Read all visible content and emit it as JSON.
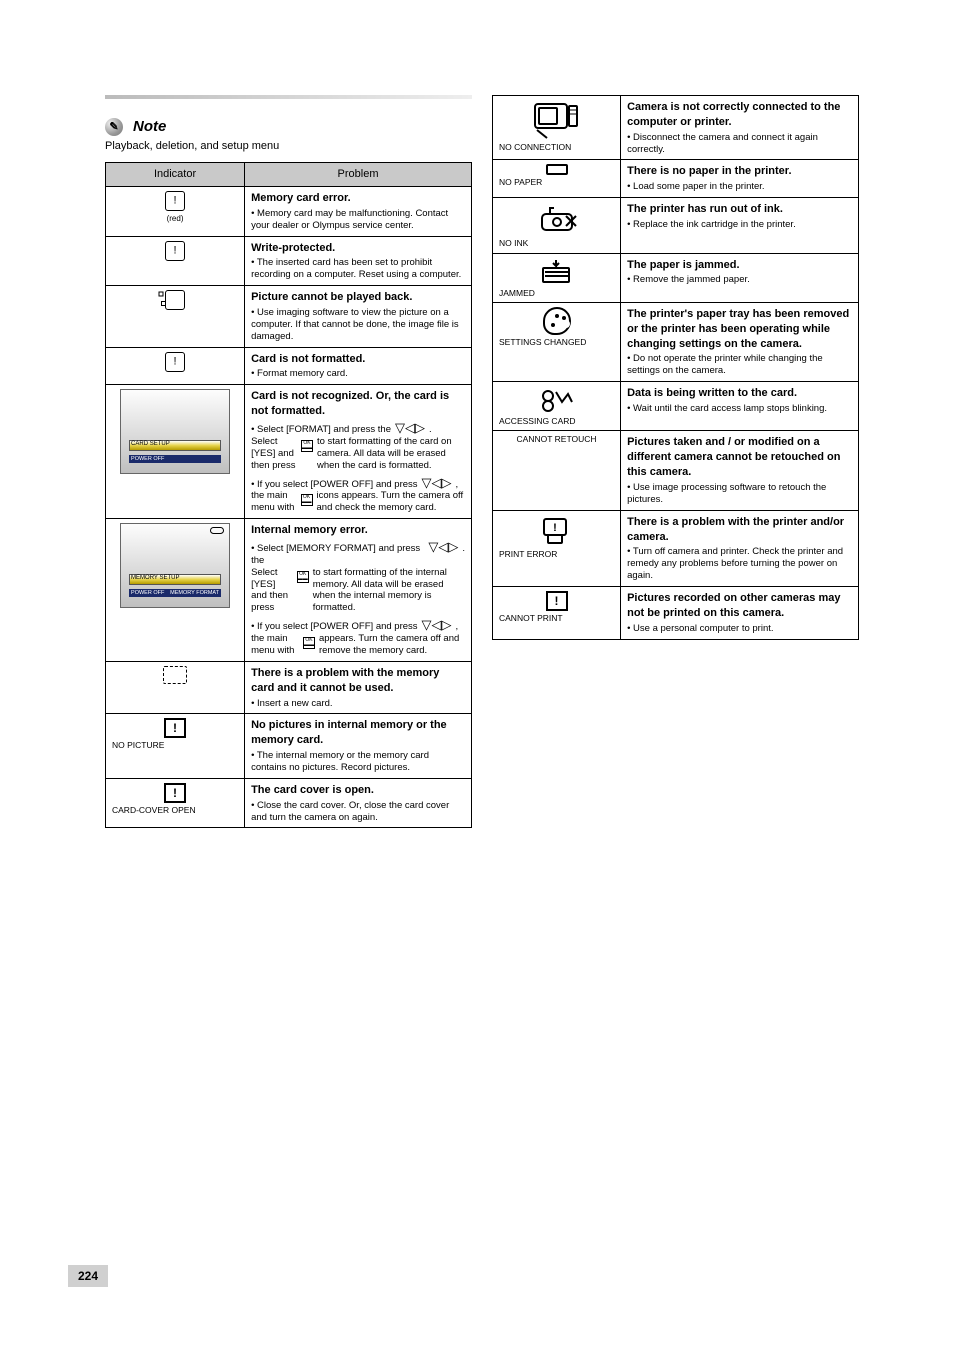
{
  "page_number": "224",
  "left": {
    "note_heading": "Note",
    "subtitle": "Playback, deletion, and setup menu",
    "header_indicator": "Indicator",
    "header_problem": "Problem",
    "rows": [
      {
        "key": "card1_red",
        "icon_caption": "(red)",
        "head": "Memory card error.",
        "desc": "• Memory card may be malfunctioning. Contact your dealer or Olympus service center."
      },
      {
        "key": "card2",
        "icon_caption": "",
        "head": "Write-protected.",
        "desc": "• The inserted card has been set to prohibit recording on a computer. Reset using a computer."
      },
      {
        "key": "card3",
        "icon_caption": "",
        "head": "Picture cannot be played back.",
        "desc": "• Use imaging software to view the picture on a computer. If that cannot be done, the image file is damaged."
      },
      {
        "key": "card4",
        "icon_caption": "",
        "head": "Card is not formatted.",
        "desc": "• Format memory card."
      },
      {
        "key": "screen1",
        "screen_yellow": "CARD SETUP",
        "screen_blue_l": "POWER OFF",
        "screen_blue_r": "",
        "head": "Card is not recognized. Or, the card is not formatted.",
        "desc_a": "• Select [FORMAT] and press the  icon. Select [YES] and then press  to start formatting of the card on camera. All data will be erased when the card is formatted.",
        "desc_b": "• If you select [POWER OFF] and press , the main menu with  icons appears. Turn the camera off and check the memory card."
      },
      {
        "key": "screen2",
        "screen_yellow": "MEMORY SETUP",
        "screen_blue_l": "POWER OFF",
        "screen_blue_r": "MEMORY FORMAT",
        "head": "Internal memory error.",
        "desc_a": "• Select [MEMORY FORMAT] and press the  icon. Select [YES] and then press  to start formatting of the internal memory. All data will be erased when the internal memory is formatted.",
        "desc_b": "• If you select [POWER OFF] and press , the main menu appears. Turn the camera off and remove the memory card."
      },
      {
        "key": "dashed",
        "icon_caption": "",
        "head": "There is a problem with the memory card and it cannot be used.",
        "desc": "• Insert a new card."
      },
      {
        "key": "nopic",
        "icon_caption": "NO PICTURE",
        "head": "No pictures in internal memory or the memory card.",
        "desc": "• The internal memory or the memory card contains no pictures. Record pictures."
      },
      {
        "key": "cover",
        "icon_caption": "CARD-COVER OPEN",
        "head": "The card cover is open.",
        "desc": "• Close the card cover. Or, close the card cover and turn the camera on again."
      }
    ]
  },
  "right": {
    "rows": [
      {
        "key": "noconn",
        "cap": "NO CONNECTION",
        "head": "Camera is not correctly connected to the computer or printer.",
        "desc": "• Disconnect the camera and connect it again correctly."
      },
      {
        "key": "nopaper",
        "cap": "NO PAPER",
        "head": "There is no paper in the printer.",
        "desc": "• Load some paper in the printer."
      },
      {
        "key": "noink",
        "cap": "NO INK",
        "head": "The printer has run out of ink.",
        "desc": "• Replace the ink cartridge in the printer."
      },
      {
        "key": "jammed",
        "cap": "JAMMED",
        "head": "The paper is jammed.",
        "desc": "• Remove the jammed paper."
      },
      {
        "key": "settings",
        "cap": "SETTINGS CHANGED",
        "head": "The printer's paper tray has been removed or the printer has been operating while changing settings on the camera.",
        "desc": "• Do not operate the printer while changing the settings on the camera."
      },
      {
        "key": "ac",
        "cap": "ACCESSING CARD",
        "head": "Data is being written to the card.",
        "desc": "• Wait until the card access lamp stops blinking."
      },
      {
        "key": "retouch",
        "cap": "CANNOT RETOUCH",
        "head": "Pictures taken and / or modified on a different camera cannot be retouched on this camera.",
        "desc": "• Use image processing software to retouch the pictures."
      },
      {
        "key": "perr",
        "cap": "PRINT ERROR",
        "head": "There is a problem with the printer and/or camera.",
        "desc": "• Turn off camera and printer. Check the printer and remedy any problems before turning the power on again."
      },
      {
        "key": "cantp",
        "cap": "CANNOT PRINT",
        "head": "Pictures recorded on other cameras may not be printed on this camera.",
        "desc": "• Use a personal computer to print."
      }
    ]
  }
}
